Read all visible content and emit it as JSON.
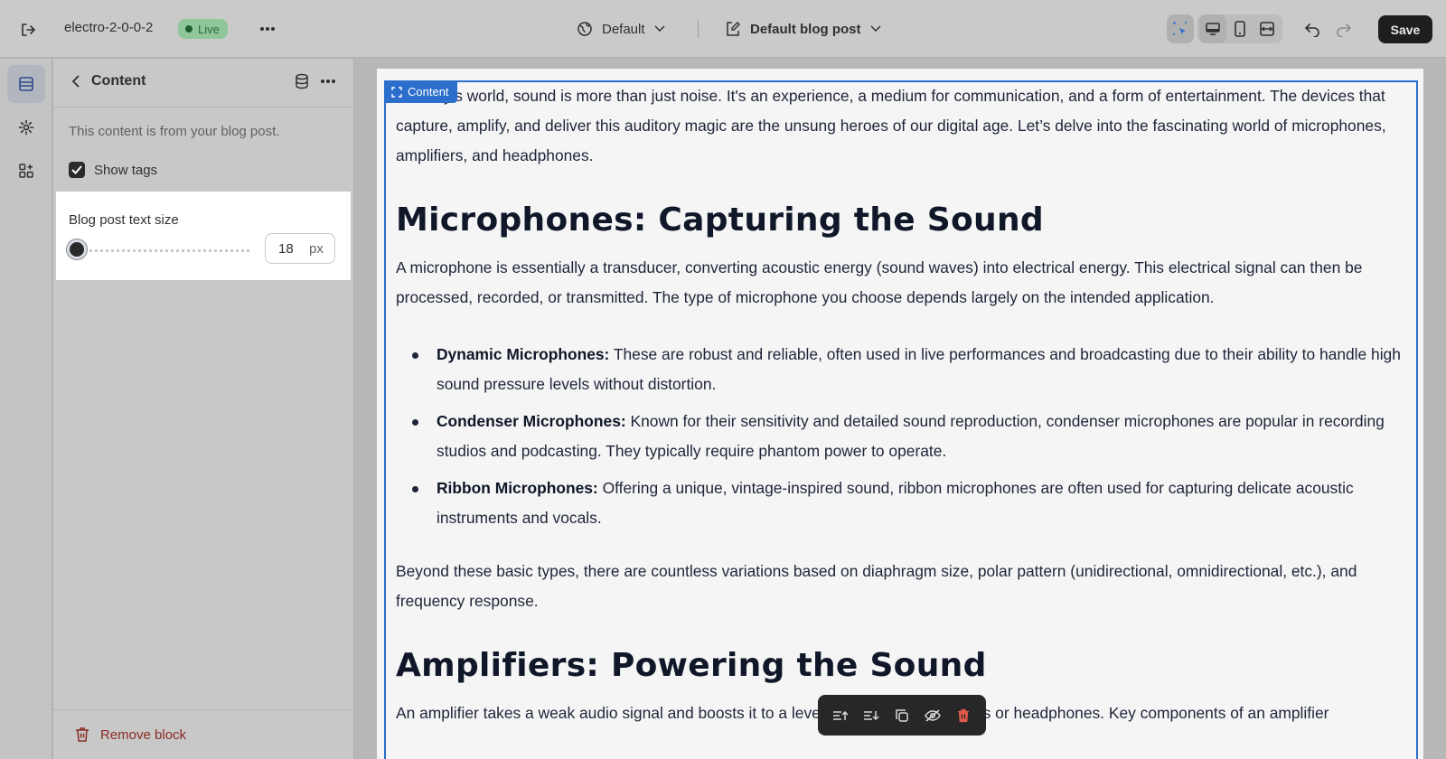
{
  "topbar": {
    "store_name": "electro-2-0-0-2",
    "status_badge": "Live",
    "theme_label": "Default",
    "template_label": "Default blog post",
    "save_label": "Save"
  },
  "panel": {
    "title": "Content",
    "note": "This content is from your blog post.",
    "show_tags_label": "Show tags",
    "show_tags_checked": true,
    "text_size_label": "Blog post text size",
    "text_size_value": "18",
    "text_size_unit": "px",
    "remove_block_label": "Remove block"
  },
  "canvas": {
    "selection_tag": "Content",
    "intro": "In today's world, sound is more than just noise. It's an experience, a medium for communication, and a form of entertainment. The devices that capture, amplify, and deliver this auditory magic are the unsung heroes of our digital age. Let’s delve into the fascinating world of microphones, amplifiers, and headphones.",
    "heading1": "Microphones: Capturing the Sound",
    "para1": "A microphone is essentially a transducer, converting acoustic energy (sound waves) into electrical energy. This electrical signal can then be processed, recorded, or transmitted. The type of microphone you choose depends largely on the intended application.",
    "bullets": [
      {
        "term": "Dynamic Microphones:",
        "text": " These are robust and reliable, often used in live performances and broadcasting due to their ability to handle high sound pressure levels without distortion."
      },
      {
        "term": "Condenser Microphones:",
        "text": " Known for their sensitivity and detailed sound reproduction, condenser microphones are popular in recording studios and podcasting. They typically require phantom power to operate."
      },
      {
        "term": "Ribbon Microphones:",
        "text": " Offering a unique, vintage-inspired sound, ribbon microphones are often used for capturing delicate acoustic instruments and vocals."
      }
    ],
    "para2": "Beyond these basic types, there are countless variations based on diaphragm size, polar pattern (unidirectional, omnidirectional, etc.), and frequency response.",
    "heading2": "Amplifiers: Powering the Sound",
    "para3": "An amplifier takes a weak audio signal and boosts it to a level that can drive speakers or headphones. Key components of an amplifier"
  },
  "colors": {
    "accent": "#2c6ecb",
    "live_badge": "#8fc79b",
    "save_button": "#1e1e1e",
    "remove": "#8a2b22"
  },
  "icons": {
    "exit": "exit-icon",
    "more": "more-horizontal-icon",
    "theme": "globe-icon",
    "template": "edit-page-icon",
    "inspector": "select-cursor-icon",
    "desktop": "desktop-icon",
    "mobile": "mobile-icon",
    "fullwidth": "fullwidth-icon",
    "undo": "undo-icon",
    "redo": "redo-icon",
    "sections": "sections-icon",
    "settings": "gear-icon",
    "apps": "apps-icon",
    "back": "chevron-left-icon",
    "database": "database-icon",
    "trash": "trash-icon"
  }
}
